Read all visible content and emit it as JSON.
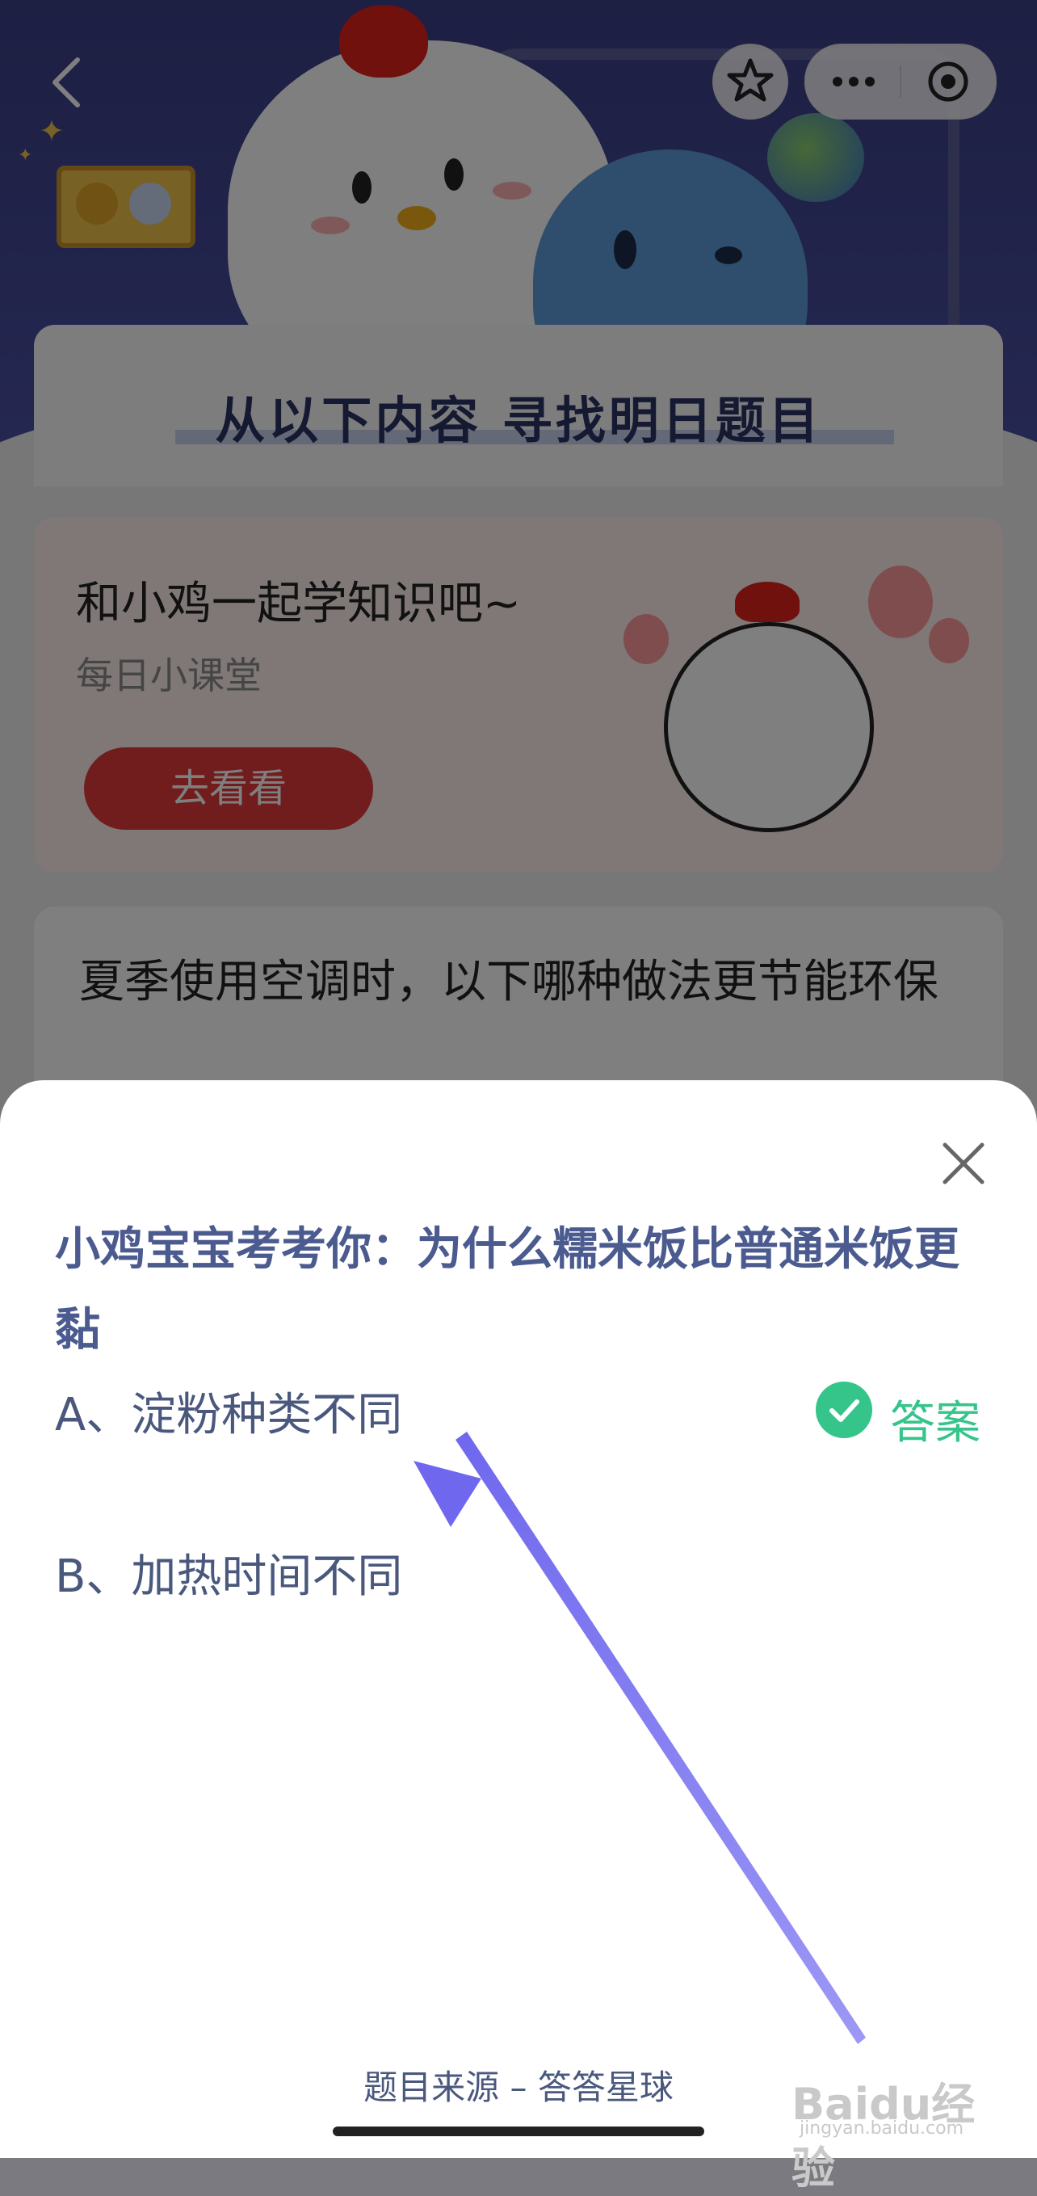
{
  "background_page": {
    "section_heading": "从以下内容  寻找明日题目",
    "lesson_card": {
      "title": "和小鸡一起学知识吧~",
      "subtitle": "每日小课堂",
      "button_label": "去看看"
    },
    "question_card": {
      "text": "夏季使用空调时，以下哪种做法更节能环保"
    }
  },
  "nav": {
    "back_icon": "chevron-left-icon",
    "favorite_icon": "star-icon",
    "more_icon": "ellipsis-icon",
    "target_icon": "target-icon"
  },
  "quiz_sheet": {
    "title": "小鸡宝宝考考你：为什么糯米饭比普通米饭更黏",
    "options": [
      {
        "label": "A、淀粉种类不同"
      },
      {
        "label": "B、加热时间不同"
      }
    ],
    "answer_label": "答案",
    "source": "题目来源 – 答答星球"
  },
  "watermark": {
    "logo": "Baidu经验",
    "sub": "jingyan.baidu.com"
  },
  "colors": {
    "title_blue": "#4b5b8f",
    "answer_green": "#35c48a",
    "arrow": "#7b74f0"
  }
}
